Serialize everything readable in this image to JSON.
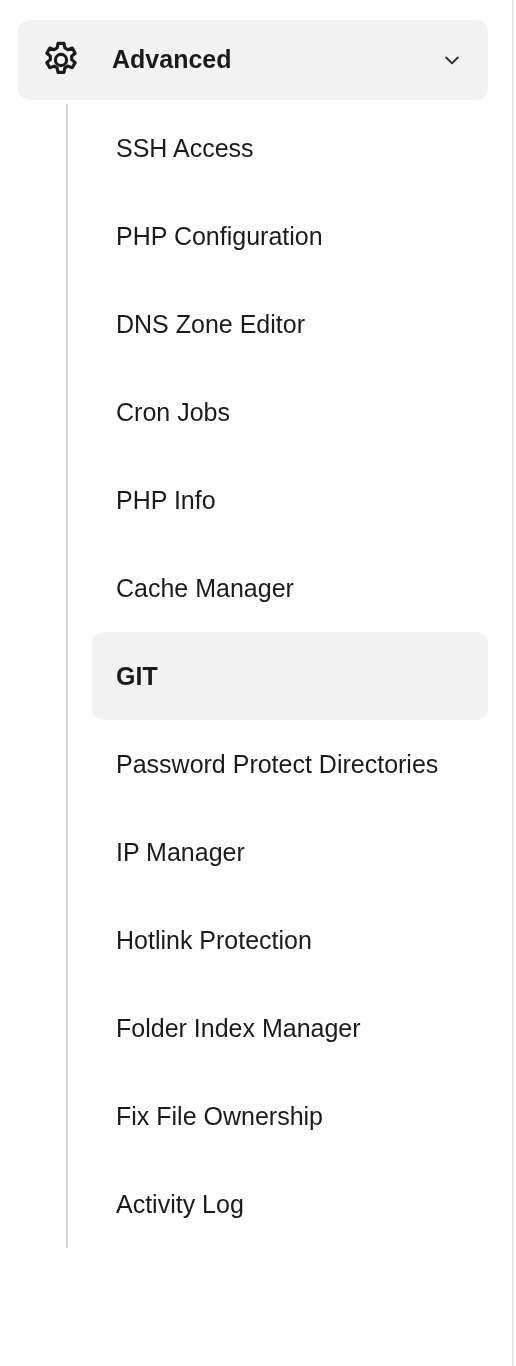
{
  "section": {
    "title": "Advanced",
    "expanded": true
  },
  "items": [
    {
      "label": "SSH Access",
      "selected": false
    },
    {
      "label": "PHP Configuration",
      "selected": false
    },
    {
      "label": "DNS Zone Editor",
      "selected": false
    },
    {
      "label": "Cron Jobs",
      "selected": false
    },
    {
      "label": "PHP Info",
      "selected": false
    },
    {
      "label": "Cache Manager",
      "selected": false
    },
    {
      "label": "GIT",
      "selected": true
    },
    {
      "label": "Password Protect Directories",
      "selected": false
    },
    {
      "label": "IP Manager",
      "selected": false
    },
    {
      "label": "Hotlink Protection",
      "selected": false
    },
    {
      "label": "Folder Index Manager",
      "selected": false
    },
    {
      "label": "Fix File Ownership",
      "selected": false
    },
    {
      "label": "Activity Log",
      "selected": false
    }
  ]
}
